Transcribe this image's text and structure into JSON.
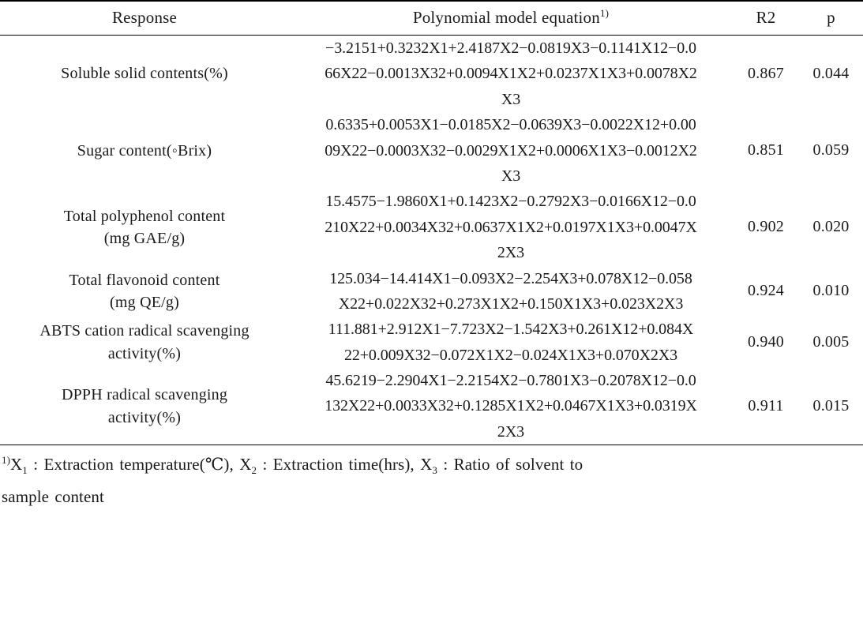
{
  "table": {
    "columns": [
      {
        "key": "response",
        "label": "Response"
      },
      {
        "key": "equation",
        "label": "Polynomial model equation",
        "label_sup": "1)"
      },
      {
        "key": "r2",
        "label": "R2"
      },
      {
        "key": "p",
        "label": "p"
      }
    ],
    "rows": [
      {
        "response_lines": [
          "Soluble solid contents(%)"
        ],
        "equation_lines": [
          "−3.2151+0.3232X1+2.4187X2−0.0819X3−0.1141X12−0.0",
          "66X22−0.0013X32+0.0094X1X2+0.0237X1X3+0.0078X2",
          "X3"
        ],
        "r2": "0.867",
        "p": "0.044"
      },
      {
        "response_lines": [
          "Sugar content(◦Brix)"
        ],
        "equation_lines": [
          "0.6335+0.0053X1−0.0185X2−0.0639X3−0.0022X12+0.00",
          "09X22−0.0003X32−0.0029X1X2+0.0006X1X3−0.0012X2",
          "X3"
        ],
        "r2": "0.851",
        "p": "0.059"
      },
      {
        "response_lines": [
          "Total polyphenol content",
          "(mg GAE/g)"
        ],
        "equation_lines": [
          "15.4575−1.9860X1+0.1423X2−0.2792X3−0.0166X12−0.0",
          "210X22+0.0034X32+0.0637X1X2+0.0197X1X3+0.0047X",
          "2X3"
        ],
        "r2": "0.902",
        "p": "0.020"
      },
      {
        "response_lines": [
          "Total flavonoid content",
          "(mg QE/g)"
        ],
        "equation_lines": [
          "125.034−14.414X1−0.093X2−2.254X3+0.078X12−0.058",
          "X22+0.022X32+0.273X1X2+0.150X1X3+0.023X2X3"
        ],
        "r2": "0.924",
        "p": "0.010"
      },
      {
        "response_lines": [
          "ABTS cation radical scavenging",
          "activity(%)"
        ],
        "equation_lines": [
          "111.881+2.912X1−7.723X2−1.542X3+0.261X12+0.084X",
          "22+0.009X32−0.072X1X2−0.024X1X3+0.070X2X3"
        ],
        "r2": "0.940",
        "p": "0.005"
      },
      {
        "response_lines": [
          "DPPH radical scavenging",
          "activity(%)"
        ],
        "equation_lines": [
          "45.6219−2.2904X1−2.2154X2−0.7801X3−0.2078X12−0.0",
          "132X22+0.0033X32+0.1285X1X2+0.0467X1X3+0.0319X",
          "2X3"
        ],
        "r2": "0.911",
        "p": "0.015"
      }
    ]
  },
  "footnote": {
    "marker": "1)",
    "line1_prefix": "X",
    "x1_sub": "1",
    "seg1": " : Extraction temperature(℃), X",
    "x2_sub": "2",
    "seg2": " : Extraction time(hrs), X",
    "x3_sub": "3",
    "seg3": " : Ratio of solvent to",
    "line2": "sample content"
  }
}
